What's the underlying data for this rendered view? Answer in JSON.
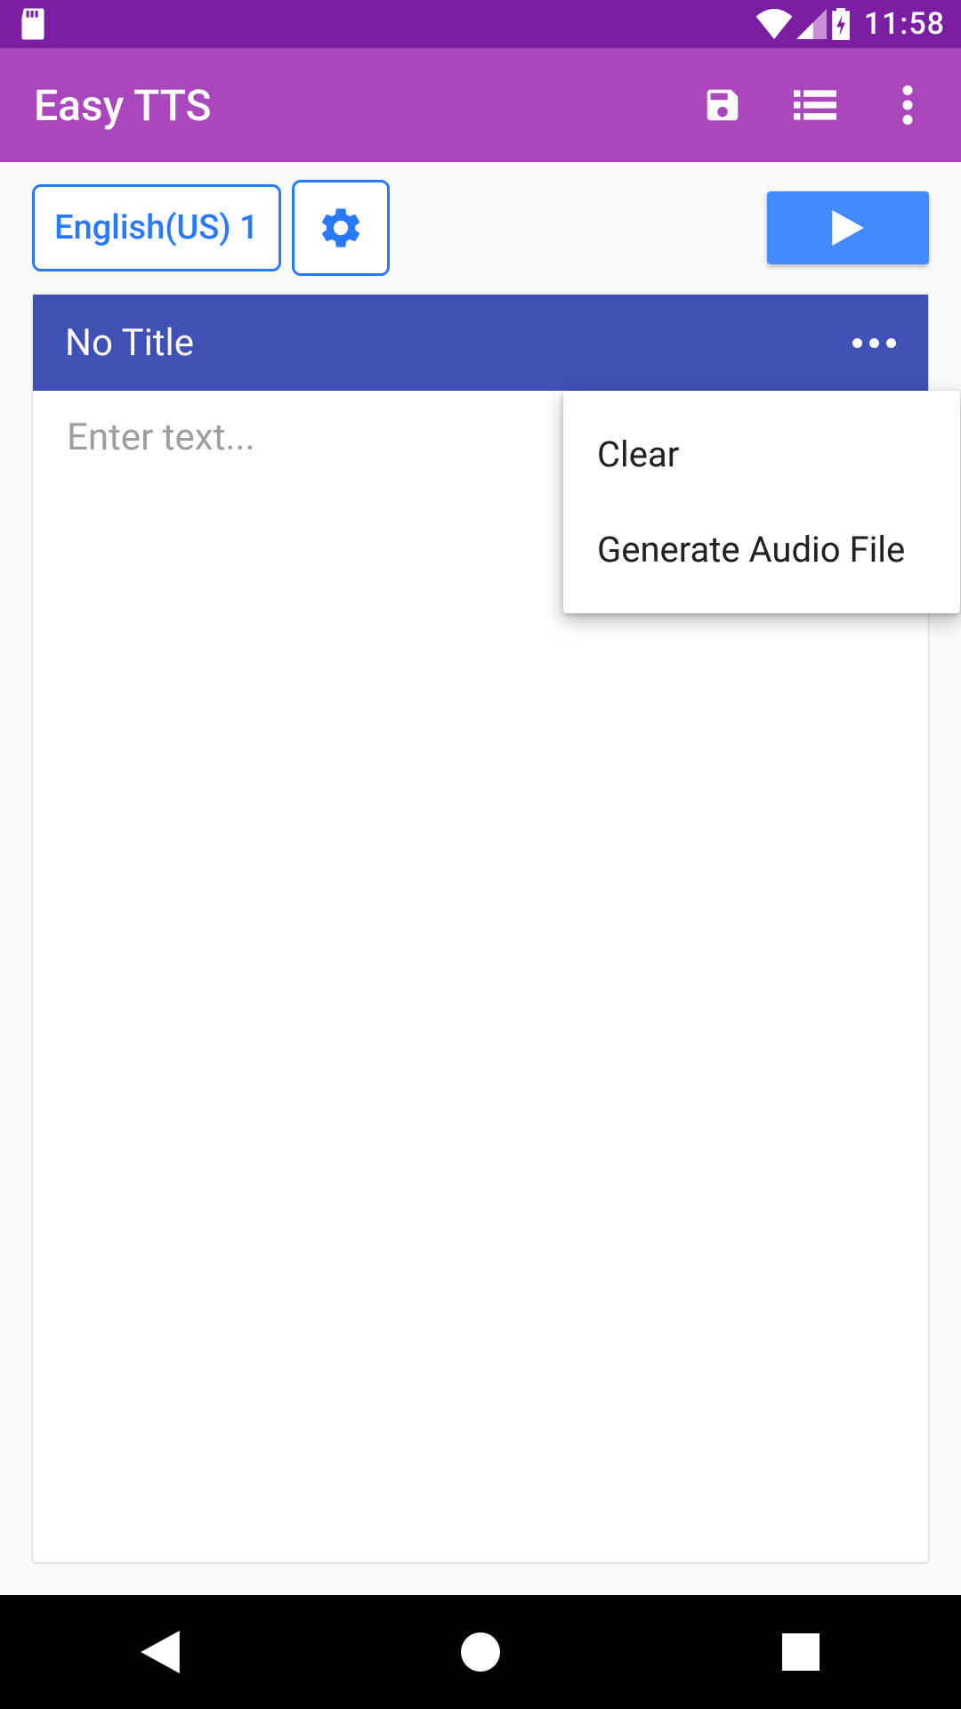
{
  "status": {
    "time": "11:58"
  },
  "appbar": {
    "title": "Easy TTS"
  },
  "toolbar": {
    "language": "English(US) 1"
  },
  "card": {
    "title": "No Title",
    "placeholder": "Enter text..."
  },
  "popup": {
    "items": [
      "Clear",
      "Generate Audio File"
    ]
  }
}
